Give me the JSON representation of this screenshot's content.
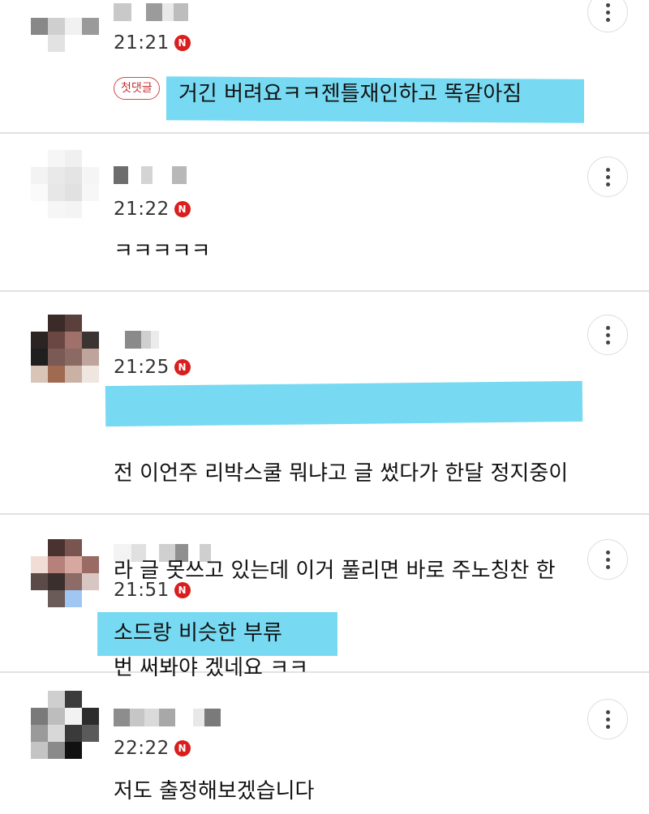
{
  "comments": [
    {
      "time": "21:21",
      "badge": "첫댓글",
      "text": "거긴 버려요ㅋㅋ젠틀재인하고 똑같아짐"
    },
    {
      "time": "21:22",
      "text": "ㅋㅋㅋㅋㅋ"
    },
    {
      "time": "21:25",
      "text_lines": [
        "전 이언주 리박스쿨 뭐냐고 글 썼다가 한달 정지중이",
        "라 글 못쓰고 있는데 이거 풀리면 바로 주노칭찬 한",
        "번 써봐야 겠네요 ㅋㅋ"
      ]
    },
    {
      "time": "21:51",
      "text": "소드랑 비슷한 부류"
    },
    {
      "time": "22:22",
      "text": "저도 출정해보겠습니다"
    }
  ],
  "time_badge_letter": "N",
  "icons": {
    "more": "more-vertical-icon",
    "time_badge": "naver-n-badge-icon"
  },
  "colors": {
    "highlight": "#5fd3f0",
    "badge_red": "#d81e1e",
    "divider": "#e2e2e2"
  }
}
